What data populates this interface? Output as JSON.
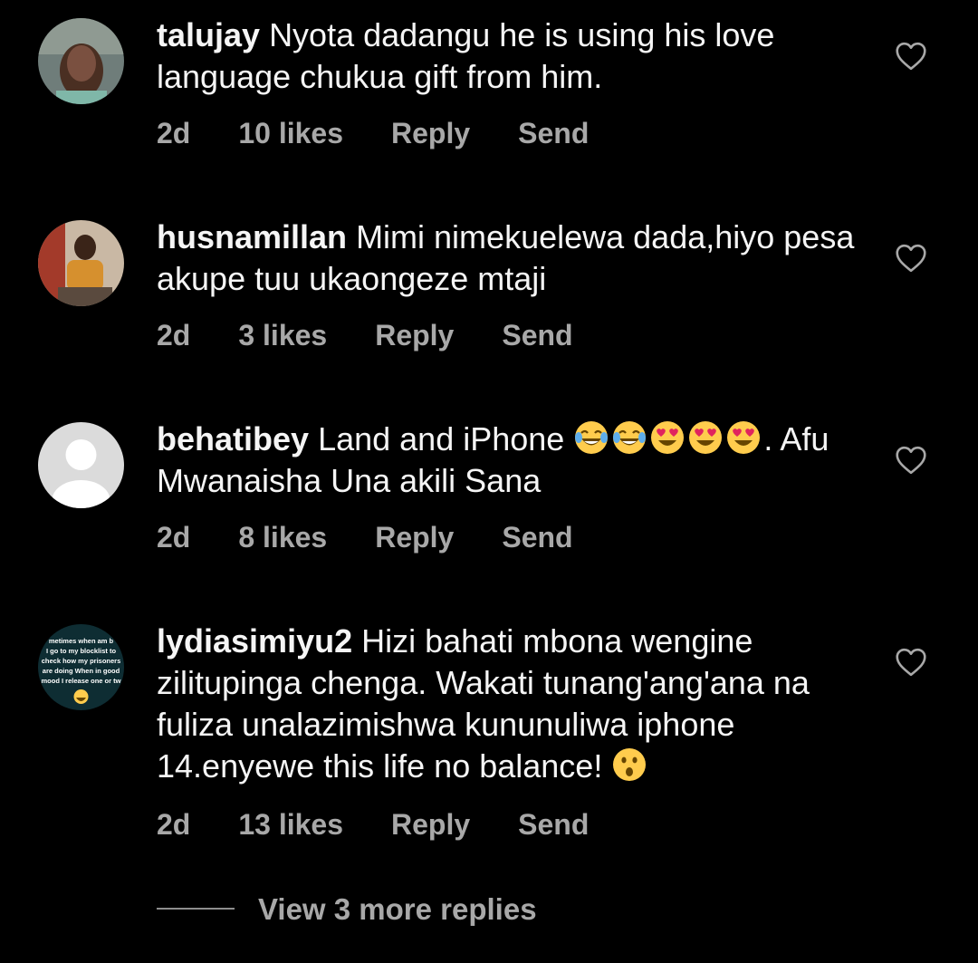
{
  "comments": [
    {
      "username": "talujay",
      "text": "Nyota dadangu he is using his love language chukua gift from him.",
      "age": "2d",
      "likes": "10 likes",
      "reply": "Reply",
      "send": "Send"
    },
    {
      "username": "husnamillan",
      "text": "Mimi nimekuelewa dada,hiyo pesa akupe tuu ukaongeze mtaji",
      "age": "2d",
      "likes": "3 likes",
      "reply": "Reply",
      "send": "Send"
    },
    {
      "username": "behatibey",
      "text_before_emoji": "Land and iPhone",
      "text_after_emoji": ". Afu Mwanaisha Una akili Sana",
      "emojis": [
        "laughing-tears",
        "laughing-tears",
        "heart-eyes",
        "heart-eyes",
        "heart-eyes"
      ],
      "age": "2d",
      "likes": "8 likes",
      "reply": "Reply",
      "send": "Send"
    },
    {
      "username": "lydiasimiyu2",
      "text": "Hizi bahati mbona wengine zilitupinga chenga. Wakati tunang'ang'ana na fuliza unalazimishwa kununuliwa iphone 14.enyewe this life no balance!",
      "emojis": [
        "astonished-face"
      ],
      "avatar_text": [
        "metimes when am b",
        "I go to my blocklist to",
        "check how my prisoners",
        "are doing When in good",
        "mood I release one or tw"
      ],
      "age": "2d",
      "likes": "13 likes",
      "reply": "Reply",
      "send": "Send"
    }
  ],
  "view_replies": "View 3 more replies",
  "colors": {
    "background": "#000000",
    "primary_text": "#f5f5f5",
    "secondary_text": "#a8a8a8"
  }
}
